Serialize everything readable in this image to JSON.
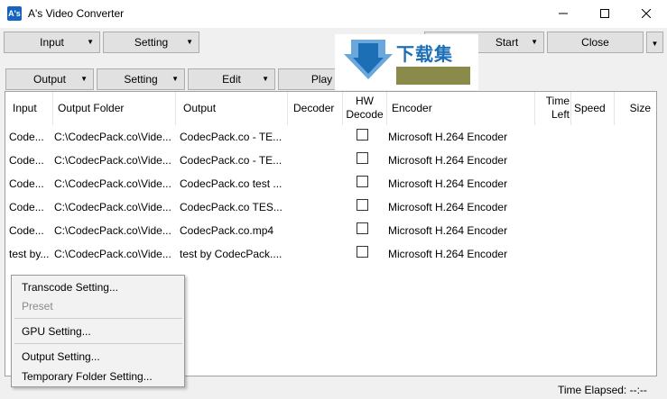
{
  "window": {
    "icon_text": "A's",
    "title": "A's Video Converter"
  },
  "toolbar_top": {
    "input": "Input",
    "setting": "Setting",
    "start": "Start",
    "close": "Close"
  },
  "toolbar_second": {
    "output": "Output",
    "setting": "Setting",
    "edit": "Edit",
    "play": "Play"
  },
  "watermark": {
    "text": "下载集"
  },
  "columns": [
    "Input",
    "Output Folder",
    "Output",
    "Decoder",
    "HW Decode",
    "Encoder",
    "Time Left",
    "Speed",
    "Size"
  ],
  "rows": [
    {
      "input": "Code...",
      "folder": "C:\\CodecPack.co\\Vide...",
      "output": "CodecPack.co - TE...",
      "decoder": "",
      "hw": false,
      "encoder": "Microsoft H.264 Encoder"
    },
    {
      "input": "Code...",
      "folder": "C:\\CodecPack.co\\Vide...",
      "output": "CodecPack.co - TE...",
      "decoder": "",
      "hw": false,
      "encoder": "Microsoft H.264 Encoder"
    },
    {
      "input": "Code...",
      "folder": "C:\\CodecPack.co\\Vide...",
      "output": "CodecPack.co test ...",
      "decoder": "",
      "hw": false,
      "encoder": "Microsoft H.264 Encoder"
    },
    {
      "input": "Code...",
      "folder": "C:\\CodecPack.co\\Vide...",
      "output": "CodecPack.co TES...",
      "decoder": "",
      "hw": false,
      "encoder": "Microsoft H.264 Encoder"
    },
    {
      "input": "Code...",
      "folder": "C:\\CodecPack.co\\Vide...",
      "output": "CodecPack.co.mp4",
      "decoder": "",
      "hw": false,
      "encoder": "Microsoft H.264 Encoder"
    },
    {
      "input": "test by...",
      "folder": "C:\\CodecPack.co\\Vide...",
      "output": "test by CodecPack....",
      "decoder": "",
      "hw": false,
      "encoder": "Microsoft H.264 Encoder"
    }
  ],
  "context_menu": {
    "transcode": "Transcode Setting...",
    "preset": "Preset",
    "gpu": "GPU Setting...",
    "output": "Output Setting...",
    "temp": "Temporary Folder Setting..."
  },
  "status": {
    "time_elapsed": "Time Elapsed: --:--"
  }
}
